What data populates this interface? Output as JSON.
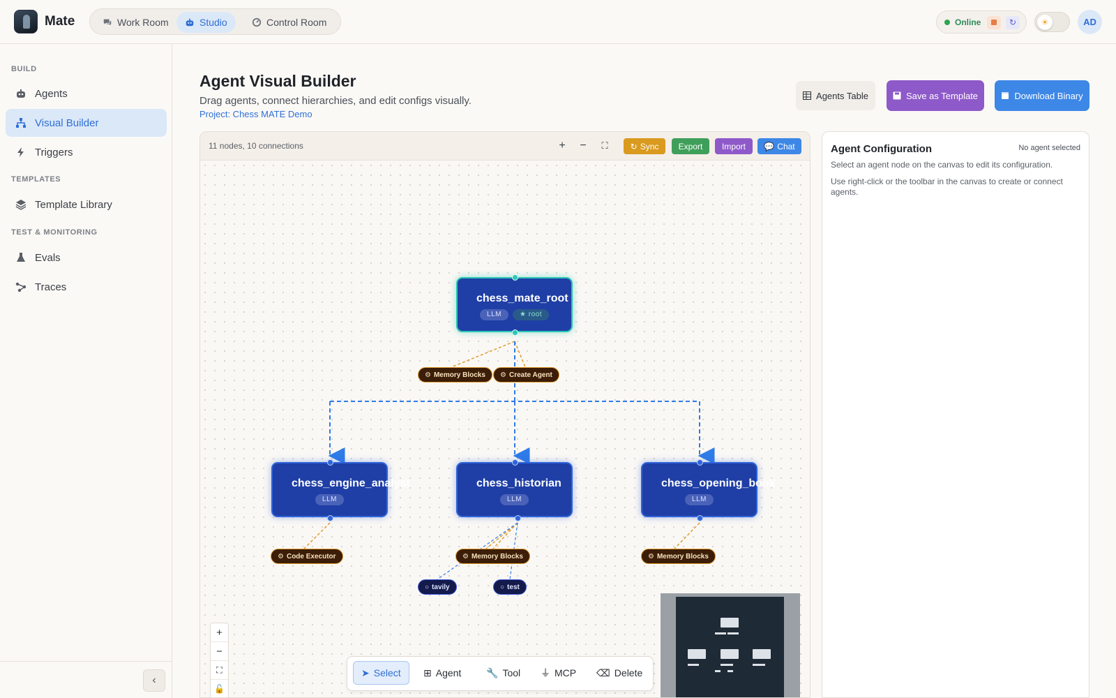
{
  "app": {
    "name": "Mate"
  },
  "nav": {
    "tabs": [
      {
        "label": "Work Room",
        "icon": "chat-icon"
      },
      {
        "label": "Studio",
        "icon": "robot-icon",
        "active": true
      },
      {
        "label": "Control Room",
        "icon": "dashboard-icon"
      }
    ]
  },
  "status": {
    "label": "Online",
    "color": "#2ea44f"
  },
  "user": {
    "initials": "AD"
  },
  "sidebar": {
    "sections": [
      {
        "label": "BUILD"
      },
      {
        "label": "TEMPLATES"
      },
      {
        "label": "TEST & MONITORING"
      }
    ],
    "items": [
      {
        "label": "Agents",
        "icon": "robot-icon"
      },
      {
        "label": "Visual Builder",
        "icon": "hierarchy-icon",
        "active": true
      },
      {
        "label": "Triggers",
        "icon": "bolt-icon"
      },
      {
        "label": "Template Library",
        "icon": "layers-icon"
      },
      {
        "label": "Evals",
        "icon": "flask-icon"
      },
      {
        "label": "Traces",
        "icon": "share-nodes-icon"
      }
    ]
  },
  "page": {
    "title": "Agent Visual Builder",
    "subtitle": "Drag agents, connect hierarchies, and edit configs visually.",
    "project": "Project: Chess MATE Demo",
    "buttons": {
      "table": "Agents Table",
      "save": "Save as Template",
      "download": "Download Binary"
    },
    "accent": {
      "save": "#8e59c9",
      "download": "#3d87e6"
    }
  },
  "canvas": {
    "counts": "11 nodes, 10 connections",
    "toolbar": {
      "sync": "Sync",
      "export": "Export",
      "import": "Import",
      "chat": "Chat"
    },
    "toolbar_colors": {
      "sync": "#d99a1f",
      "export": "#3f9f5a",
      "import": "#8e59c9",
      "chat": "#3d87e6"
    },
    "nodes": [
      {
        "name": "chess_mate_root",
        "badges": [
          "LLM",
          "root"
        ]
      },
      {
        "name": "chess_engine_analyst",
        "badges": [
          "LLM"
        ]
      },
      {
        "name": "chess_historian",
        "badges": [
          "LLM"
        ]
      },
      {
        "name": "chess_opening_book",
        "badges": [
          "LLM"
        ]
      }
    ],
    "chips": {
      "root_memory": "Memory Blocks",
      "root_create": "Create Agent",
      "engine_code": "Code Executor",
      "historian_memory": "Memory Blocks",
      "historian_tavily": "tavily",
      "historian_test": "test",
      "opening_memory": "Memory Blocks"
    },
    "modes": [
      {
        "label": "Select",
        "icon": "cursor-icon",
        "active": true
      },
      {
        "label": "Agent",
        "icon": "plus-square-icon"
      },
      {
        "label": "Tool",
        "icon": "wrench-icon"
      },
      {
        "label": "MCP",
        "icon": "plug-icon"
      },
      {
        "label": "Delete",
        "icon": "eraser-icon"
      }
    ]
  },
  "config": {
    "title": "Agent Configuration",
    "status": "No agent selected",
    "hint1": "Select an agent node on the canvas to edit its configuration.",
    "hint2": "Use right-click or the toolbar in the canvas to create or connect agents."
  }
}
